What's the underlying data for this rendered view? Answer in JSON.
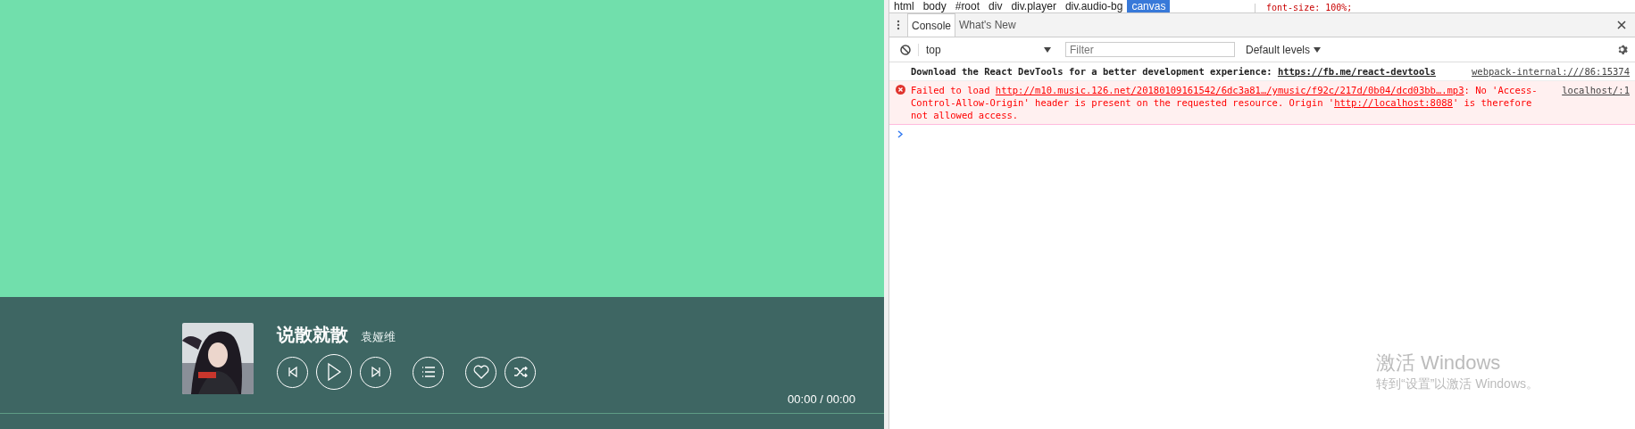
{
  "player": {
    "title": "说散就散",
    "artist": "袁娅维",
    "controls": [
      {
        "kind": "prev"
      },
      {
        "kind": "play"
      },
      {
        "kind": "next"
      },
      {
        "kind": "list"
      },
      {
        "kind": "like"
      },
      {
        "kind": "shuffle"
      }
    ],
    "time": "00:00 / 00:00"
  },
  "devtools": {
    "breadcrumbs": [
      {
        "label": "html",
        "selected": false
      },
      {
        "label": "body",
        "selected": false
      },
      {
        "label": "#root",
        "selected": false
      },
      {
        "label": "div",
        "selected": false
      },
      {
        "label": "div.player",
        "selected": false
      },
      {
        "label": "div.audio-bg",
        "selected": false
      },
      {
        "label": "canvas",
        "selected": true
      }
    ],
    "styles_line": "font-size: 100%;",
    "tabs": [
      {
        "label": "Console",
        "selected": true
      },
      {
        "label": "What's New",
        "selected": false
      }
    ],
    "context": "top",
    "filter_placeholder": "Filter",
    "levels": "Default levels",
    "messages": [
      {
        "kind": "info",
        "source": "webpack-internal:///86:15374",
        "parts": [
          {
            "text": "Download the React DevTools for a better development experience: ",
            "link": false
          },
          {
            "text": "https://fb.me/react-devtools",
            "link": true
          }
        ]
      },
      {
        "kind": "error",
        "source": "localhost/:1",
        "parts": [
          {
            "text": "Failed to load ",
            "link": false
          },
          {
            "text": "http://m10.music.126.net/20180109161542/6dc3a81…/ymusic/f92c/217d/0b04/dcd03bb….mp3",
            "link": true
          },
          {
            "text": ": No 'Access-Control-Allow-Origin' header is present on the requested resource. Origin '",
            "link": false
          },
          {
            "text": "http://localhost:8088",
            "link": true
          },
          {
            "text": "' is therefore not allowed access.",
            "link": false
          }
        ]
      }
    ]
  },
  "activation": {
    "title": "激活 Windows",
    "subtitle": "转到“设置”以激活 Windows。"
  }
}
